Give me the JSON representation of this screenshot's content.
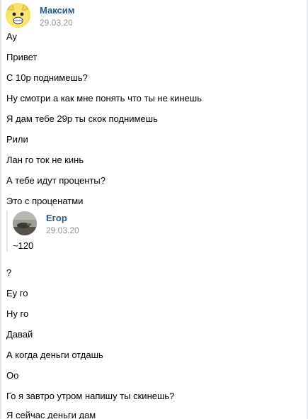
{
  "sender": {
    "name": "Максим",
    "date": "29.03.20"
  },
  "messages_before": [
    "Ау",
    "Привет",
    "С 10р поднимешь?",
    "Ну смотри а как мне понять что ты не кинешь",
    "Я дам тебе 29р ты скок поднимешь",
    "Рили",
    "Лан го ток не кинь",
    "А тебе идут проценты?",
    "Это с проценатми"
  ],
  "forwarded": {
    "name": "Егор",
    "date": "29.03.20",
    "text": "~120"
  },
  "messages_after": [
    "?",
    "Еу го",
    "Ну го",
    "Давай",
    "А когда деньги отдашь",
    "Оо",
    "Го я завтро утром напишу ты скинешь?",
    "Я сейчас деньги дам"
  ],
  "colors": {
    "link_name": "#2a5885",
    "date_gray": "#939393",
    "avatar_bg": "#f7e26a"
  },
  "icons": {
    "sender_avatar": "yellow-cartoon-avatar-icon",
    "forwarded_avatar": "photo-avatar-icon"
  }
}
